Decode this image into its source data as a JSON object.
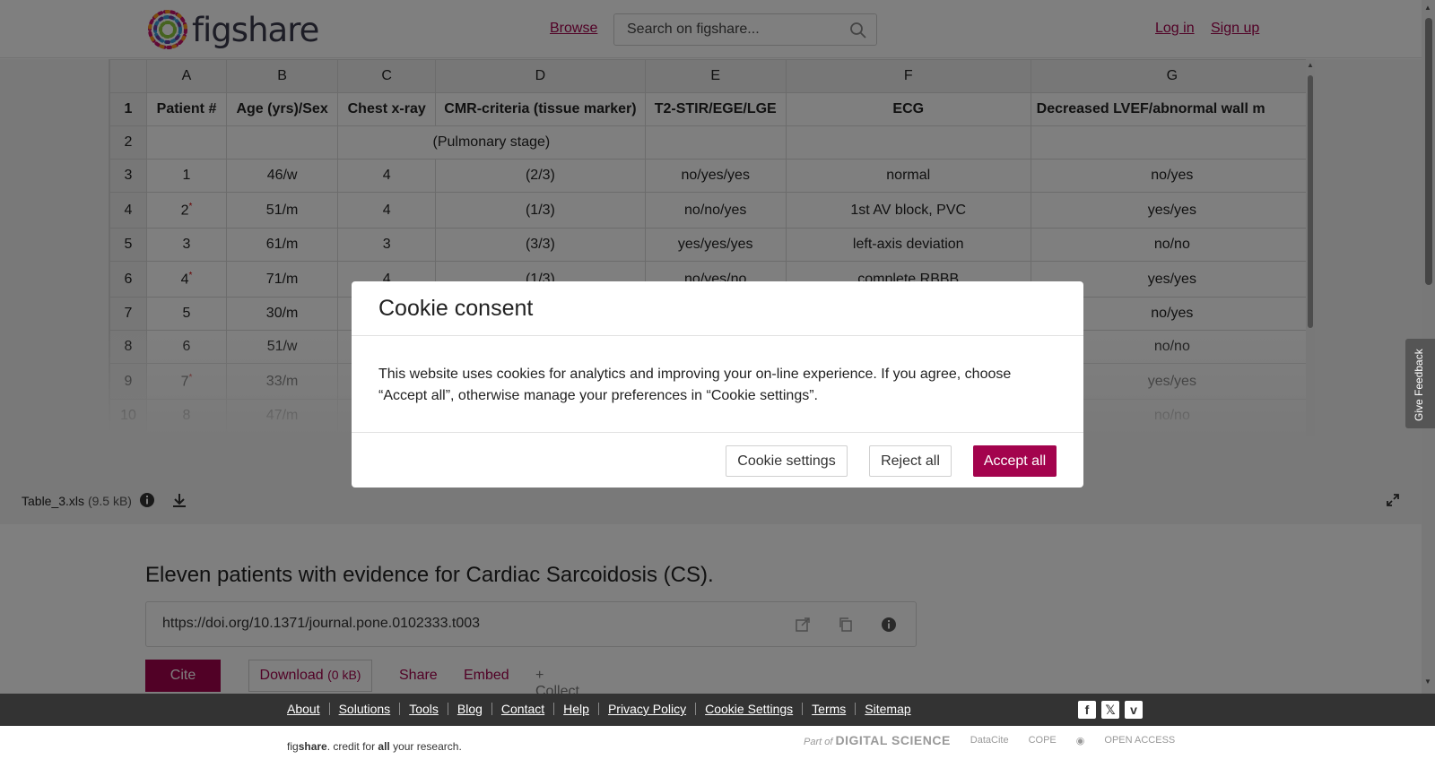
{
  "header": {
    "logo_text": "figshare",
    "browse": "Browse",
    "search_placeholder": "Search on figshare...",
    "login": "Log in",
    "signup": "Sign up"
  },
  "sheet": {
    "columns": [
      "A",
      "B",
      "C",
      "D",
      "E",
      "F",
      "G"
    ],
    "header_row": [
      "1",
      "Patient #",
      "Age (yrs)/Sex",
      "Chest x-ray",
      "CMR-criteria (tissue marker)",
      "T2-STIR/EGE/LGE",
      "ECG",
      "Decreased LVEF/abnormal wall m"
    ],
    "row2": {
      "num": "2",
      "span_text": "(Pulmonary stage)"
    },
    "rows": [
      {
        "num": "3",
        "a": "1",
        "b": "46/w",
        "c": "4",
        "d": "(2/3)",
        "e": "no/yes/yes",
        "f": "normal",
        "g": "no/yes",
        "mark": ""
      },
      {
        "num": "4",
        "a": "2",
        "b": "51/m",
        "c": "4",
        "d": "(1/3)",
        "e": "no/no/yes",
        "f": "1st AV block, PVC",
        "g": "yes/yes",
        "mark": "*"
      },
      {
        "num": "5",
        "a": "3",
        "b": "61/m",
        "c": "3",
        "d": "(3/3)",
        "e": "yes/yes/yes",
        "f": "left-axis deviation",
        "g": "no/no",
        "mark": ""
      },
      {
        "num": "6",
        "a": "4",
        "b": "71/m",
        "c": "4",
        "d": "(1/3)",
        "e": "no/yes/no",
        "f": "complete RBBB",
        "g": "yes/yes",
        "mark": "*"
      },
      {
        "num": "7",
        "a": "5",
        "b": "30/m",
        "c": "",
        "d": "",
        "e": "",
        "f": "",
        "g": "no/yes",
        "mark": ""
      },
      {
        "num": "8",
        "a": "6",
        "b": "51/w",
        "c": "",
        "d": "",
        "e": "",
        "f": "",
        "g": "no/no",
        "mark": ""
      },
      {
        "num": "9",
        "a": "7",
        "b": "33/m",
        "c": "",
        "d": "",
        "e": "",
        "f": "",
        "g": "yes/yes",
        "mark": "*"
      },
      {
        "num": "10",
        "a": "8",
        "b": "47/m",
        "c": "",
        "d": "",
        "e": "",
        "f": "",
        "g": "no/no",
        "mark": ""
      }
    ]
  },
  "file": {
    "name": "Table_3.xls",
    "size": "(9.5 kB)"
  },
  "article": {
    "title": "Eleven patients with evidence for Cardiac Sarcoidosis (CS).",
    "doi": "https://doi.org/10.1371/journal.pone.0102333.t003",
    "cite": "Cite",
    "download": "Download",
    "download_size": "(0 kB)",
    "share": "Share",
    "embed": "Embed",
    "collect": "+ Collect"
  },
  "footer": {
    "links": [
      "About",
      "Solutions",
      "Tools",
      "Blog",
      "Contact",
      "Help",
      "Privacy Policy",
      "Cookie Settings",
      "Terms",
      "Sitemap"
    ],
    "tagline_fig": "fig",
    "tagline_share": "share",
    "tagline_mid": ". credit for ",
    "tagline_all": "all",
    "tagline_end": " your research.",
    "partners": [
      "Part of",
      "DIGITAL SCIENCE",
      "DataCite",
      "COPE",
      "OPEN ACCESS"
    ]
  },
  "modal": {
    "title": "Cookie consent",
    "body": "This website uses cookies for analytics and improving your on-line experience. If you agree, choose “Accept all”, otherwise manage your preferences in “Cookie settings”.",
    "settings": "Cookie settings",
    "reject": "Reject all",
    "accept": "Accept all"
  },
  "feedback": "Give Feedback",
  "colors": {
    "brand": "#a3034d",
    "footer_bg": "#333333",
    "overlay": "rgba(0,0,0,0.5)"
  }
}
